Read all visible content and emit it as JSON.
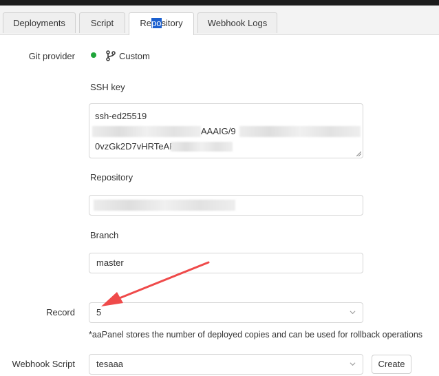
{
  "tabs": [
    {
      "label": "Deployments"
    },
    {
      "label": "Script"
    },
    {
      "label_pre": "Re",
      "label_hl": "po",
      "label_post": "sitory"
    },
    {
      "label": "Webhook Logs"
    }
  ],
  "git_provider": {
    "label": "Git provider",
    "value": "Custom",
    "status_color": "#20a53a"
  },
  "ssh_key": {
    "label": "SSH key",
    "line1": "ssh-ed25519",
    "line2_fragment": "AAAIG/9",
    "line3_fragment": "0vzGk2D7vHRTeAF"
  },
  "repository": {
    "label": "Repository",
    "value": ""
  },
  "branch": {
    "label": "Branch",
    "value": "master"
  },
  "record": {
    "label": "Record",
    "value": "5",
    "note": "*aaPanel stores the number of deployed copies and can be used for rollback operations"
  },
  "webhook_script": {
    "label": "Webhook Script",
    "value": "tesaaa",
    "create_label": "Create"
  },
  "icons": {
    "provider": "git-branch-icon",
    "dropdown": "chevron-down-icon",
    "annotation": "red-arrow-icon"
  },
  "colors": {
    "annotation_arrow": "#ef4a4a",
    "selection_highlight": "#1a5fcf"
  }
}
